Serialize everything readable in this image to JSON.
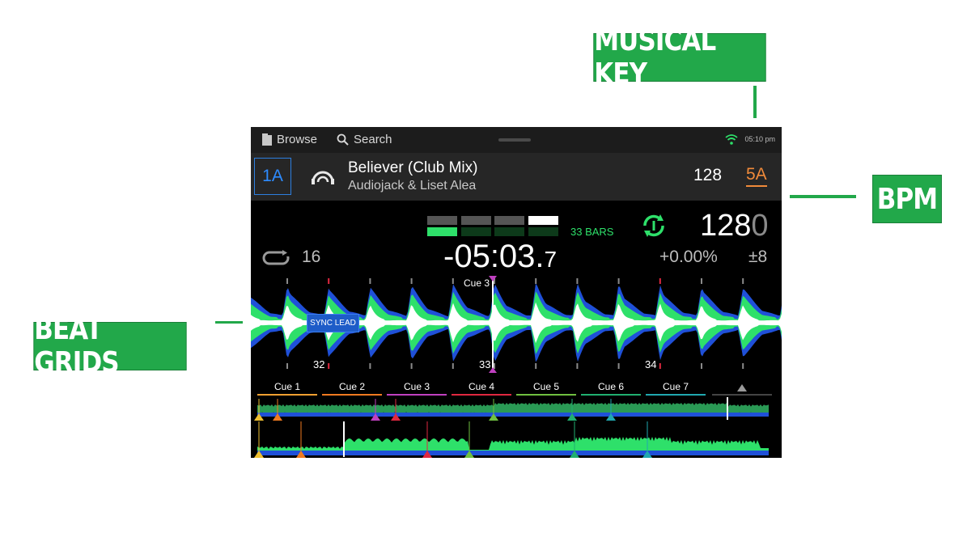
{
  "callouts": {
    "musical_key": "MUSICAL KEY",
    "bpm": "BPM",
    "beat_grids": "BEAT GRIDS"
  },
  "topbar": {
    "browse_label": "Browse",
    "search_label": "Search",
    "clock": "05:10 pm"
  },
  "track": {
    "deck_key": "1A",
    "title": "Believer (Club Mix)",
    "artist": "Audiojack & Liset Alea",
    "bpm": "128",
    "key": "5A"
  },
  "status": {
    "bars_label": "33 BARS",
    "bpm_main": "128",
    "bpm_decimal": "0",
    "loop_size": "16",
    "time_main": "-05:03.",
    "time_tenths": "7",
    "pitch": "+0.00%",
    "pitch_range": "±8"
  },
  "waveform": {
    "cue_label": "Cue 3",
    "sync_label": "SYNC LEAD",
    "beat_numbers": [
      "32",
      "33",
      "34"
    ]
  },
  "cues": [
    {
      "label": "Cue 1",
      "color": "#f0a030"
    },
    {
      "label": "Cue 2",
      "color": "#f07a20"
    },
    {
      "label": "Cue 3",
      "color": "#c040c0"
    },
    {
      "label": "Cue 4",
      "color": "#e02840"
    },
    {
      "label": "Cue 5",
      "color": "#70c040"
    },
    {
      "label": "Cue 6",
      "color": "#20b070"
    },
    {
      "label": "Cue 7",
      "color": "#20a8b0"
    }
  ],
  "colors": {
    "callout_green": "#22a84a",
    "accent_blue": "#2d8bff",
    "key_orange": "#f08a3a",
    "meter_green": "#2ee06a"
  }
}
